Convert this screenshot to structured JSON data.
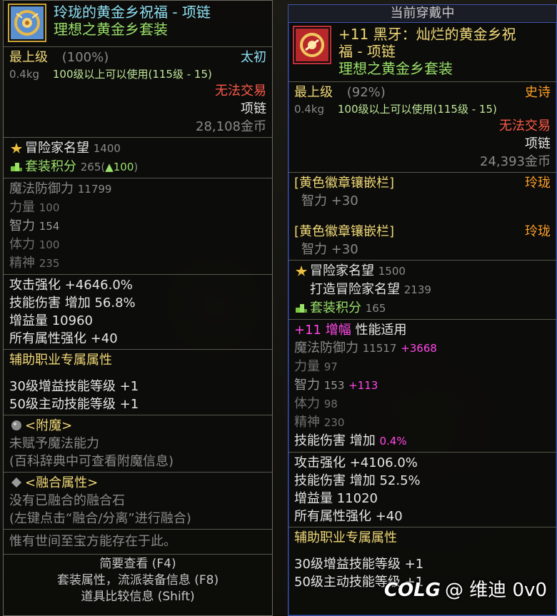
{
  "left": {
    "title": "玲珑的黄金乡祝福 - 项链",
    "subtitle": "理想之黄金乡套装",
    "grade": "最上级",
    "grade_pct": "(100%)",
    "rarity": "太初",
    "weight": "0.4kg",
    "level_req": "100级以上可以使用(115级 - 15)",
    "trade": "无法交易",
    "slot": "项链",
    "price": "28,108金币",
    "fame_label": "冒险家名望",
    "fame_value": "1400",
    "set_label": "套装积分",
    "set_value": "265(",
    "set_up": "▲100",
    "set_close": ")",
    "magic_def_label": "魔法防御力",
    "magic_def": "11799",
    "stats": [
      {
        "label": "力量",
        "value": "100"
      },
      {
        "label": "智力",
        "value": "154"
      },
      {
        "label": "体力",
        "value": "100"
      },
      {
        "label": "精神",
        "value": "235"
      }
    ],
    "attack": "攻击强化 +4646.0%",
    "skill_dmg": "技能伤害 增加 56.8%",
    "buff": "增益量 10960",
    "elem": "所有属性强化 +40",
    "support_header": "辅助职业专属属性",
    "skill30": "30级增益技能等级 +1",
    "skill50": "50级主动技能等级 +1",
    "enchant_header": "<附魔>",
    "enchant_none": "未赋予魔法能力",
    "enchant_hint": "(百科辞典中可查看附魔信息)",
    "fusion_header": "<融合属性>",
    "fusion_none": "没有已融合的融合石",
    "fusion_hint": "(左键点击“融合/分离”进行融合)",
    "flavor": "惟有世间至宝方能存在于此。",
    "foot1": "简要查看 (F4)",
    "foot2": "套装属性，流派装备信息 (F8)",
    "foot3": "道具比较信息 (Shift)"
  },
  "right": {
    "panel_title": "当前穿戴中",
    "title_line1": "+11 黑牙：灿烂的黄金乡祝",
    "title_line2": "福 - 项链",
    "subtitle": "理想之黄金乡套装",
    "grade": "最上级",
    "grade_pct": "(92%)",
    "rarity": "史诗",
    "weight": "0.4kg",
    "level_req": "100级以上可以使用(115级 - 15)",
    "trade": "无法交易",
    "slot": "项链",
    "price": "24,393金币",
    "emblem1_label": "[黄色徽章镶嵌栏]",
    "emblem1_type": "玲珑",
    "emblem1_stat": "智力 +30",
    "emblem2_label": "[黄色徽章镶嵌栏]",
    "emblem2_type": "玲珑",
    "emblem2_stat": "智力 +30",
    "fame_label": "冒险家名望",
    "fame_value": "1500",
    "forge_fame_label": "打造冒险家名望",
    "forge_fame_value": "2139",
    "set_label": "套装积分",
    "set_value": "165",
    "amp_prefix": "+11 增幅",
    "amp_suffix": "性能适用",
    "magic_def_label": "魔法防御力",
    "magic_def": "11517",
    "magic_def_bonus": "+3668",
    "stats": [
      {
        "label": "力量",
        "value": "97",
        "bonus": ""
      },
      {
        "label": "智力",
        "value": "153",
        "bonus": "+113"
      },
      {
        "label": "体力",
        "value": "98",
        "bonus": ""
      },
      {
        "label": "精神",
        "value": "230",
        "bonus": ""
      }
    ],
    "amp_skill_label": "技能伤害 增加",
    "amp_skill_value": "0.4%",
    "attack": "攻击强化 +4106.0%",
    "skill_dmg": "技能伤害 增加 52.5%",
    "buff": "增益量 11020",
    "elem": "所有属性强化 +40",
    "support_header": "辅助职业专属属性",
    "skill30": "30级增益技能等级 +1",
    "skill50": "50级主动技能等级 +1"
  },
  "watermark": {
    "logo": "COLG",
    "text": "@ 维迪 0v0"
  }
}
